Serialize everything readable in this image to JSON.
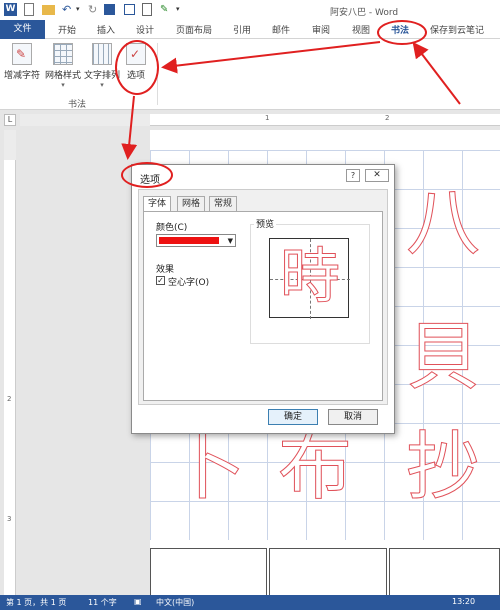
{
  "titlebar": {
    "logo": "W",
    "title": "阿安八巴 - Word",
    "quick_access_icons": [
      "new-doc-icon",
      "open-icon",
      "undo-icon",
      "redo-icon",
      "save-icon",
      "print-icon",
      "touch-mode-icon"
    ]
  },
  "tabs": {
    "file": "文件",
    "items": [
      "开始",
      "插入",
      "设计",
      "页面布局",
      "引用",
      "邮件",
      "审阅",
      "视图",
      "书法",
      "保存到云笔记"
    ],
    "active": "书法"
  },
  "ribbon": {
    "buttons": [
      {
        "label": "增减字符",
        "icon": "add-remove-chars-icon"
      },
      {
        "label": "网格样式",
        "icon": "grid-style-icon"
      },
      {
        "label": "文字排列",
        "icon": "text-arrange-icon"
      },
      {
        "label": "选项",
        "icon": "options-icon"
      }
    ],
    "group_label": "书法"
  },
  "rulers": {
    "corner": "L",
    "h_numbers": [
      "1",
      "2"
    ],
    "v_numbers": [
      "2",
      "3"
    ]
  },
  "document": {
    "characters": [
      "八",
      "貝",
      "卜",
      "布",
      "抄"
    ]
  },
  "dialog": {
    "title": "选项",
    "help": "?",
    "close": "✕",
    "tabs": [
      "字体",
      "网格",
      "常规"
    ],
    "active_tab": "字体",
    "color_label": "颜色(C)",
    "color_value": "#ee1111",
    "effect_label": "效果",
    "hollow_checkbox_label": "空心字(O)",
    "hollow_checked": true,
    "preview_label": "预览",
    "preview_char": "時",
    "ok": "确定",
    "cancel": "取消"
  },
  "statusbar": {
    "page": "第 1 页，共 1 页",
    "words": "11 个字",
    "language": "中文(中国)",
    "time": "13:20"
  },
  "colors": {
    "brand": "#2b579a",
    "annotation": "#e02020",
    "hollow_stroke": "#e0525a"
  }
}
